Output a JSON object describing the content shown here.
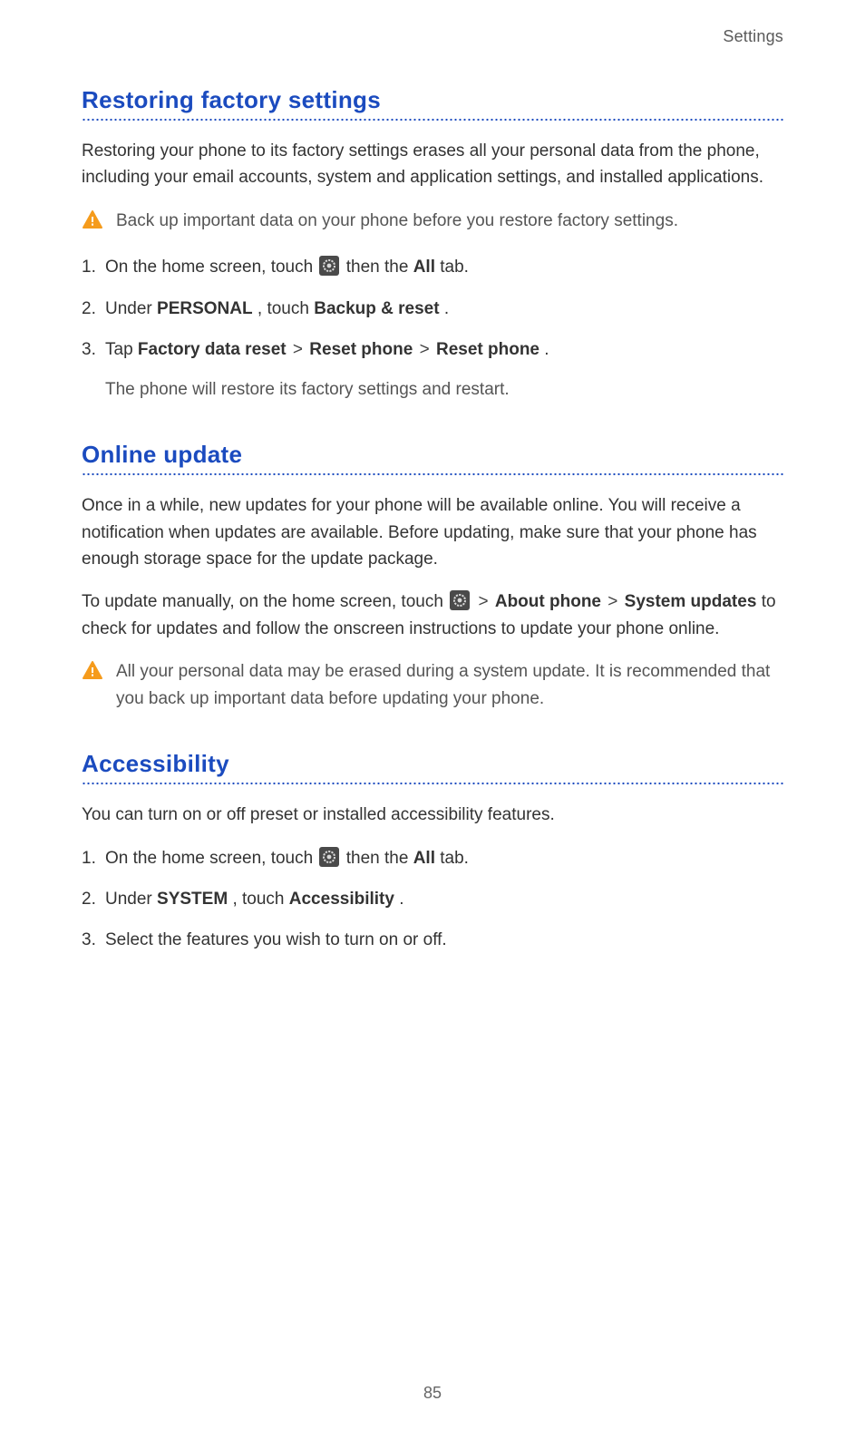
{
  "header": {
    "running": "Settings"
  },
  "footer": {
    "page_number": "85"
  },
  "symbols": {
    "gt": ">"
  },
  "sections": {
    "restore": {
      "title": "Restoring factory settings",
      "intro": "Restoring your phone to its factory settings erases all your personal data from the phone, including your email accounts, system and application settings, and installed applications.",
      "warning": "Back up important data on your phone before you restore factory settings.",
      "steps": {
        "s1_a": "On the home screen, touch ",
        "s1_b": " then the ",
        "s1_all": "All",
        "s1_c": " tab.",
        "s2_a": "Under ",
        "s2_b": "PERSONAL",
        "s2_c": ", touch ",
        "s2_d": "Backup & reset",
        "s2_e": ".",
        "s3_a": "Tap ",
        "s3_b": "Factory data reset",
        "s3_c": "Reset phone",
        "s3_d": "Reset phone",
        "s3_e": ".",
        "s3_sub": "The phone will restore its factory settings and restart."
      }
    },
    "update": {
      "title": "Online update",
      "intro": "Once in a while, new updates for your phone will be available online. You will receive a notification when updates are available. Before updating, make sure that your phone has enough storage space for the update package.",
      "line2_a": "To update manually, on the home screen, touch ",
      "line2_b1": "About phone",
      "line2_b2": "System updates",
      "line2_c": " to check for updates and follow the onscreen instructions to update your phone online.",
      "warning": "All your personal data may be erased during a system update. It is recommended that you back up important data before updating your phone."
    },
    "access": {
      "title": "Accessibility",
      "intro": "You can turn on or off preset or installed accessibility features.",
      "steps": {
        "s1_a": "On the home screen, touch ",
        "s1_b": " then the ",
        "s1_all": "All",
        "s1_c": " tab.",
        "s2_a": "Under ",
        "s2_b": "SYSTEM",
        "s2_c": ", touch ",
        "s2_d": "Accessibility",
        "s2_e": ".",
        "s3": "Select the features you wish to turn on or off."
      }
    }
  }
}
